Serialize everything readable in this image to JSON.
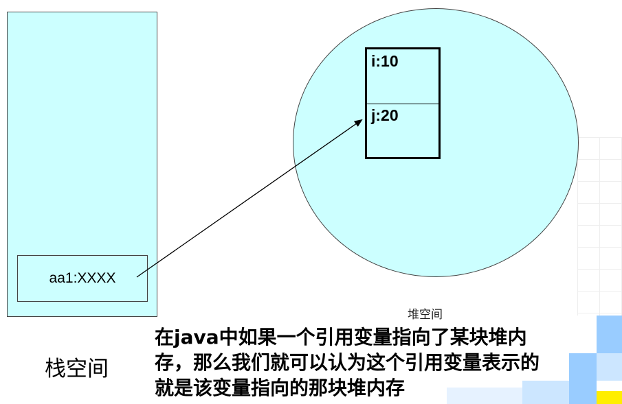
{
  "stack": {
    "label": "栈空间",
    "ref_text": "aa1:XXXX"
  },
  "heap": {
    "label": "堆空间",
    "fields": [
      {
        "text": "i:10"
      },
      {
        "text": "j:20"
      }
    ]
  },
  "caption": {
    "lines": [
      "在java中如果一个引用变量指向了某块堆内",
      "存，那么我们就可以认为这个引用变量表示的",
      "就是该变量指向的那块堆内存"
    ]
  },
  "colors": {
    "fill": "#ccffff",
    "deco_blue": "#99ccff",
    "deco_light": "#cce6ff",
    "deco_yellow": "#ffee00"
  }
}
